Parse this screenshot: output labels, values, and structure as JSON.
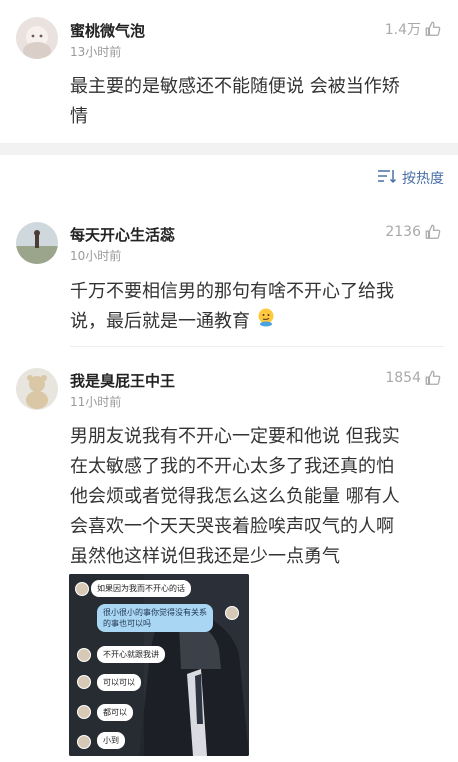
{
  "top_comment": {
    "username": "蜜桃微气泡",
    "time": "13小时前",
    "likes": "1.4万",
    "text_line1": "最主要的是敏感还不能随便说 会被当作矫",
    "text_line2": "情"
  },
  "sort_bar": {
    "label": "按热度"
  },
  "comments": [
    {
      "username": "每天开心生活蕊",
      "time": "10小时前",
      "likes": "2136",
      "text_line1": "千万不要相信男的那句有啥不开心了给我",
      "text_line2": "说，最后就是一通教育"
    },
    {
      "username": "我是臭屁王中王",
      "time": "11小时前",
      "likes": "1854",
      "text_lines": [
        "男朋友说我有不开心一定要和他说 但我实",
        "在太敏感了我的不开心太多了我还真的怕",
        "他会烦或者觉得我怎么这么负能量 哪有人",
        "会喜欢一个天天哭丧着脸唉声叹气的人啊",
        "虽然他这样说但我还是少一点勇气"
      ],
      "attached_chat": {
        "messages": [
          {
            "side": "left",
            "text": "如果因为我而不开心的话"
          },
          {
            "side": "right",
            "text_line1": "很小很小的事你觉得没有关系",
            "text_line2": "的事也可以吗"
          },
          {
            "side": "left",
            "text": "不开心就跟我讲"
          },
          {
            "side": "left",
            "text": "可以可以"
          },
          {
            "side": "left",
            "text": "都可以"
          },
          {
            "side": "left",
            "text": "小到"
          }
        ]
      }
    }
  ],
  "colors": {
    "like_gray": "#aaaaaa",
    "sort_blue": "#4a6fa5",
    "chat_blue_bubble": "#a9d6f3"
  }
}
